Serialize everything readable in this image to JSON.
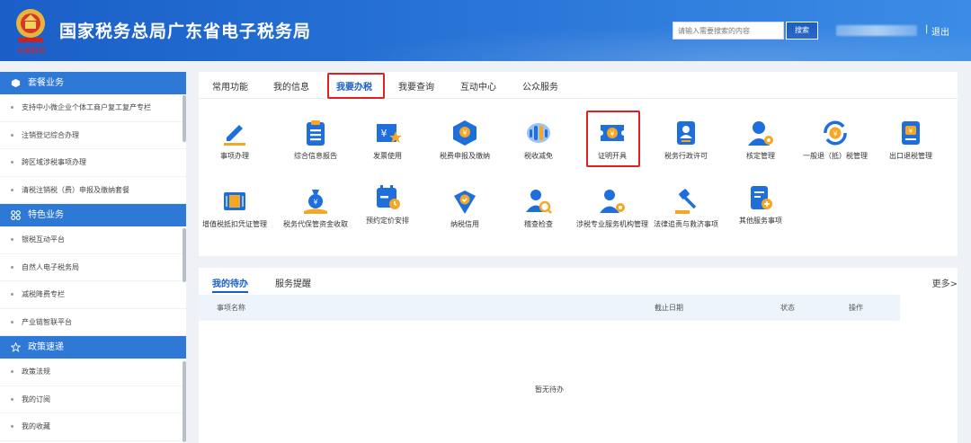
{
  "header": {
    "title": "国家税务总局广东省电子税务局",
    "emblem_caption": "中国税务",
    "search_placeholder": "请输入需要搜索的内容",
    "search_button": "搜索",
    "separator": "|",
    "logout": "退出"
  },
  "sidebar": {
    "sections": [
      {
        "title": "套餐业务",
        "icon": "cube-icon",
        "items": [
          "支持中小微企业个体工商户复工复产专栏",
          "注销登记综合办理",
          "跨区域涉税事项办理",
          "清税注销税（费）申报及缴纳套餐"
        ]
      },
      {
        "title": "特色业务",
        "icon": "grid-icon",
        "items": [
          "银税互动平台",
          "自然人电子税务局",
          "减税降费专栏",
          "产业链智联平台"
        ]
      },
      {
        "title": "政策速递",
        "icon": "star-icon",
        "items": [
          "政策法规",
          "我的订阅",
          "我的收藏"
        ]
      }
    ]
  },
  "tabs": [
    "常用功能",
    "我的信息",
    "我要办税",
    "我要查询",
    "互动中心",
    "公众服务"
  ],
  "active_tab": "我要办税",
  "services": [
    {
      "label": "事项办理",
      "icon": "pen-icon"
    },
    {
      "label": "综合信息报告",
      "icon": "clipboard-icon"
    },
    {
      "label": "发票使用",
      "icon": "invoice-icon"
    },
    {
      "label": "税费申报及缴纳",
      "icon": "tax-box-icon"
    },
    {
      "label": "税收减免",
      "icon": "coin-stack-icon"
    },
    {
      "label": "证明开具",
      "icon": "certificate-ticket-icon"
    },
    {
      "label": "税务行政许可",
      "icon": "id-card-icon"
    },
    {
      "label": "核定管理",
      "icon": "user-gear-icon"
    },
    {
      "label": "一般退（抵）税管理",
      "icon": "refund-cycle-icon"
    },
    {
      "label": "出口退税管理",
      "icon": "export-refund-icon"
    },
    {
      "label": "增值税抵扣凭证管理",
      "icon": "voucher-icon"
    },
    {
      "label": "税务代保管资金收取",
      "icon": "money-bag-icon"
    },
    {
      "label": "预约定价安排",
      "icon": "calendar-clock-icon"
    },
    {
      "label": "纳税信用",
      "icon": "credit-shield-icon"
    },
    {
      "label": "稽查检查",
      "icon": "inspector-icon"
    },
    {
      "label": "涉税专业服务机构管理",
      "icon": "agent-icon"
    },
    {
      "label": "法律追责与救济事项",
      "icon": "gavel-icon"
    },
    {
      "label": "其他服务事项",
      "icon": "document-plus-icon"
    }
  ],
  "highlighted_service": "证明开具",
  "todo": {
    "tabs": [
      "我的待办",
      "服务提醒"
    ],
    "more": "更多>",
    "columns": [
      "事项名称",
      "截止日期",
      "状态",
      "操作"
    ],
    "empty_text": "暂无待办"
  },
  "colors": {
    "header_blue": "#1a5fc7",
    "sidebar_head": "#2e78d6",
    "highlight_red": "#e02020",
    "icon_blue": "#1e6fdc",
    "icon_orange": "#f5a623"
  }
}
